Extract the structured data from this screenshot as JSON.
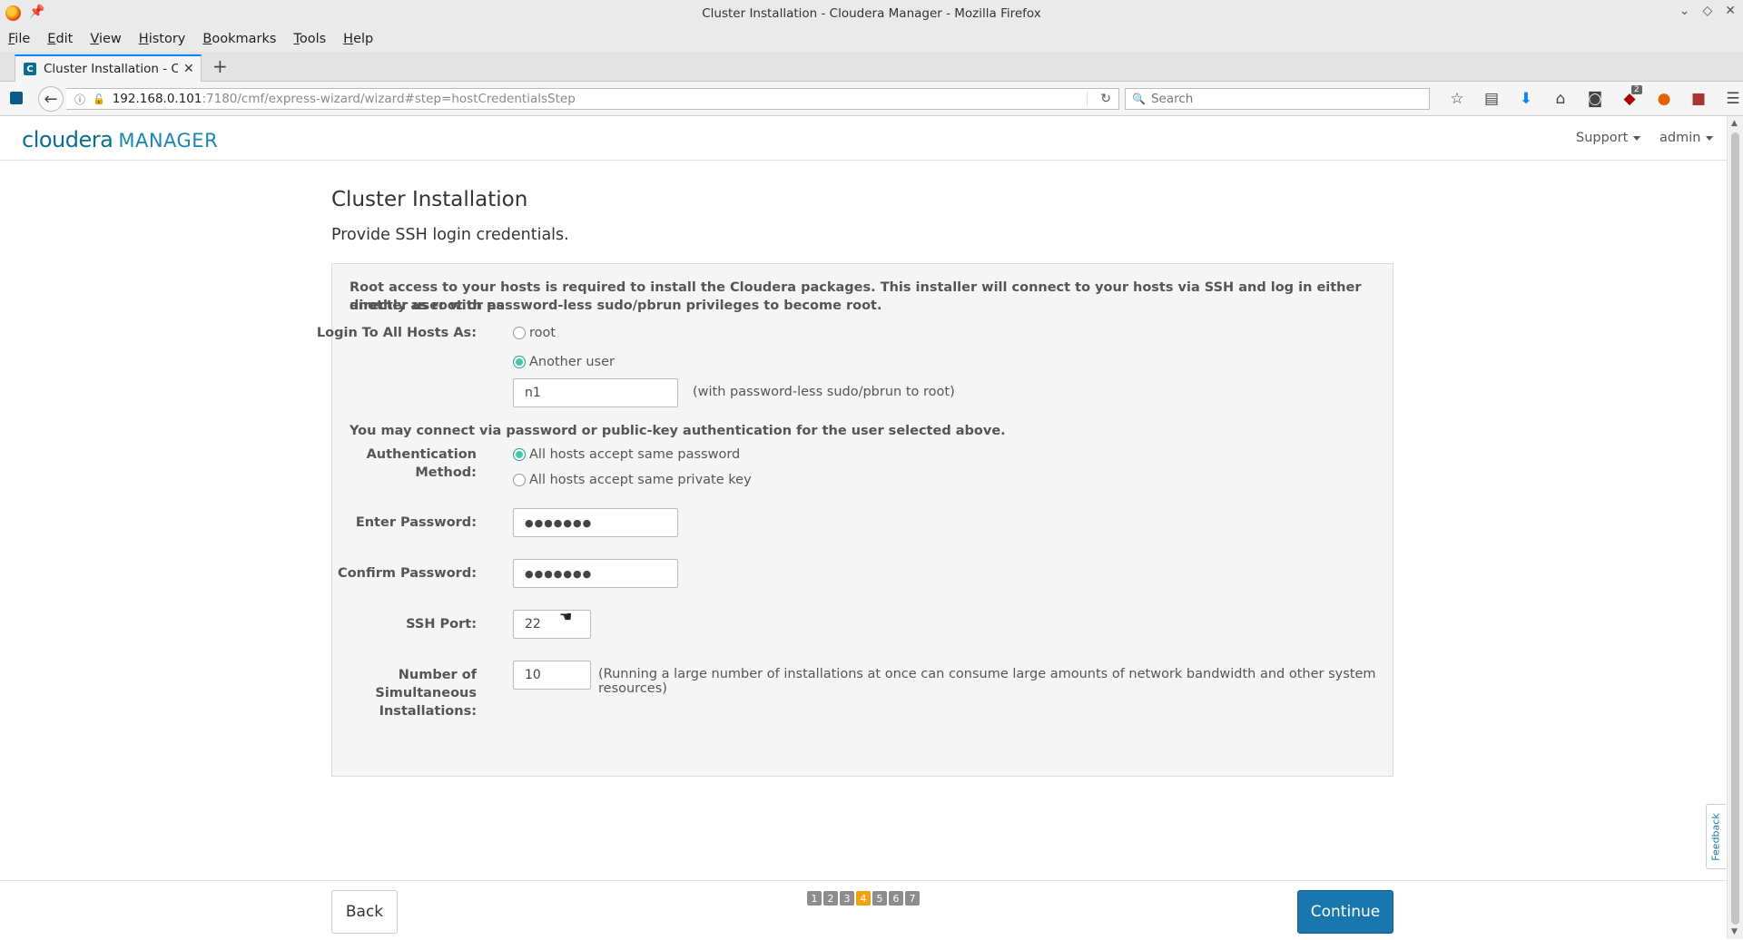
{
  "window": {
    "title": "Cluster Installation - Cloudera Manager - Mozilla Firefox"
  },
  "menu": [
    "File",
    "Edit",
    "View",
    "History",
    "Bookmarks",
    "Tools",
    "Help"
  ],
  "tab": {
    "title": "Cluster Installation - Clou",
    "favicon": "C",
    "close": "✕",
    "new_tab": "+"
  },
  "nav": {
    "url_host": "192.168.0.101",
    "url_path": ":7180/cmf/express-wizard/wizard#step=hostCredentialsStep",
    "search_placeholder": "Search",
    "ublock_badge": "2"
  },
  "header": {
    "logo_primary": "cloudera",
    "logo_secondary": "MANAGER",
    "support_label": "Support",
    "admin_label": "admin"
  },
  "page": {
    "title": "Cluster Installation",
    "subtitle": "Provide SSH login credentials."
  },
  "form": {
    "intro_line1": "Root access to your hosts is required to install the Cloudera packages. This installer will connect to your hosts via SSH and log in either directly as root or as",
    "intro_line2": "another user with password-less sudo/pbrun privileges to become root.",
    "login_label": "Login To All Hosts As:",
    "login_options": [
      {
        "label": "root",
        "selected": false
      },
      {
        "label": "Another user",
        "selected": true
      }
    ],
    "username_value": "n1",
    "username_hint": "(with password-less sudo/pbrun to root)",
    "auth_intro": "You may connect via password or public-key authentication for the user selected above.",
    "auth_label_line1": "Authentication",
    "auth_label_line2": "Method:",
    "auth_options": [
      {
        "label": "All hosts accept same password",
        "selected": true
      },
      {
        "label": "All hosts accept same private key",
        "selected": false
      }
    ],
    "password_label": "Enter Password:",
    "password_value": "●●●●●●●",
    "confirm_label": "Confirm Password:",
    "confirm_value": "●●●●●●●",
    "ssh_port_label": "SSH Port:",
    "ssh_port_value": "22",
    "simul_label_line1": "Number of",
    "simul_label_line2": "Simultaneous",
    "simul_label_line3": "Installations:",
    "simul_value": "10",
    "simul_hint": "(Running a large number of installations at once can consume large amounts of network bandwidth and other system resources)"
  },
  "footer": {
    "back_label": "Back",
    "continue_label": "Continue",
    "steps": [
      "1",
      "2",
      "3",
      "4",
      "5",
      "6",
      "7"
    ],
    "current_step": "4"
  },
  "feedback_label": "Feedback",
  "colors": {
    "primary": "#1a77ad",
    "step_current": "#f0a30a",
    "radio_on": "#3fc7a8"
  }
}
